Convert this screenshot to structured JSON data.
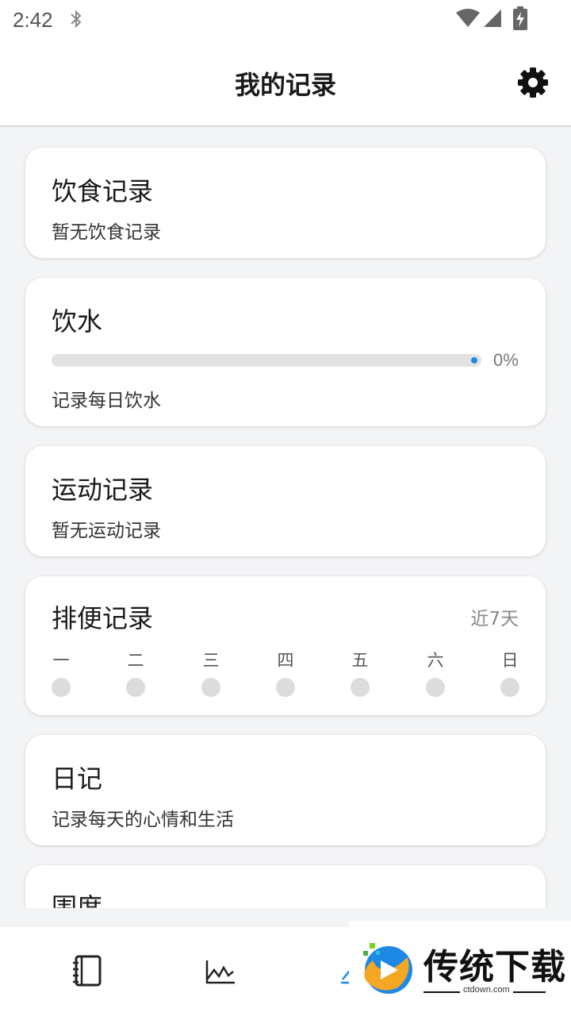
{
  "status_bar": {
    "time": "2:42",
    "icons": [
      "bluetooth-icon",
      "wifi-icon",
      "signal-icon",
      "battery-charging-icon"
    ]
  },
  "header": {
    "title": "我的记录",
    "settings_icon": "gear-icon"
  },
  "cards": {
    "diet": {
      "title": "饮食记录",
      "subtitle": "暂无饮食记录"
    },
    "water": {
      "title": "饮水",
      "progress": 0,
      "progress_label": "0%",
      "subtitle": "记录每日饮水"
    },
    "exercise": {
      "title": "运动记录",
      "subtitle": "暂无运动记录"
    },
    "bowel": {
      "title": "排便记录",
      "range_label": "近7天",
      "days": [
        "一",
        "二",
        "三",
        "四",
        "五",
        "六",
        "日"
      ]
    },
    "diary": {
      "title": "日记",
      "subtitle": "记录每天的心情和生活"
    },
    "measurements": {
      "title": "围度"
    }
  },
  "bottom_nav": {
    "items": [
      {
        "icon": "notebook-icon"
      },
      {
        "icon": "line-chart-icon"
      },
      {
        "icon": "records-icon",
        "active": true
      }
    ]
  },
  "watermark": {
    "title": "传统下载",
    "url": "ctdown.com"
  },
  "colors": {
    "accent": "#1e88e5",
    "background": "#f3f4f6",
    "card": "#ffffff",
    "dot_inactive": "#dcdcdc"
  }
}
